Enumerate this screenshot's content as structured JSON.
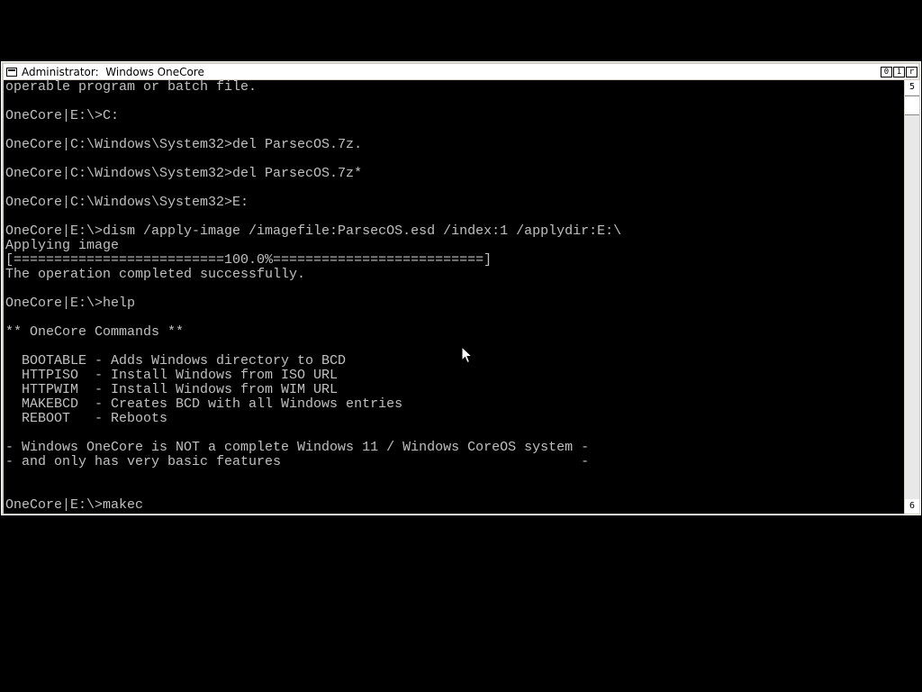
{
  "window": {
    "title": "Administrator:  Windows OneCore",
    "buttons": {
      "minimize": "0",
      "maximize": "1",
      "close": "r"
    }
  },
  "scrollbar": {
    "up_glyph": "5",
    "down_glyph": "6"
  },
  "console": {
    "lines": [
      "operable program or batch file.",
      "",
      "OneCore|E:\\>C:",
      "",
      "OneCore|C:\\Windows\\System32>del ParsecOS.7z.",
      "",
      "OneCore|C:\\Windows\\System32>del ParsecOS.7z*",
      "",
      "OneCore|C:\\Windows\\System32>E:",
      "",
      "OneCore|E:\\>dism /apply-image /imagefile:ParsecOS.esd /index:1 /applydir:E:\\",
      "Applying image",
      "[==========================100.0%==========================]",
      "The operation completed successfully.",
      "",
      "OneCore|E:\\>help",
      "",
      "** OneCore Commands **",
      "",
      "  BOOTABLE - Adds Windows directory to BCD",
      "  HTTPISO  - Install Windows from ISO URL",
      "  HTTPWIM  - Install Windows from WIM URL",
      "  MAKEBCD  - Creates BCD with all Windows entries",
      "  REBOOT   - Reboots",
      "",
      "- Windows OneCore is NOT a complete Windows 11 / Windows CoreOS system -",
      "- and only has very basic features                                     -",
      "",
      "",
      "OneCore|E:\\>makec"
    ]
  },
  "colors": {
    "console_bg": "#000000",
    "console_fg": "#c0c0c0",
    "titlebar_bg": "#ffffff"
  }
}
